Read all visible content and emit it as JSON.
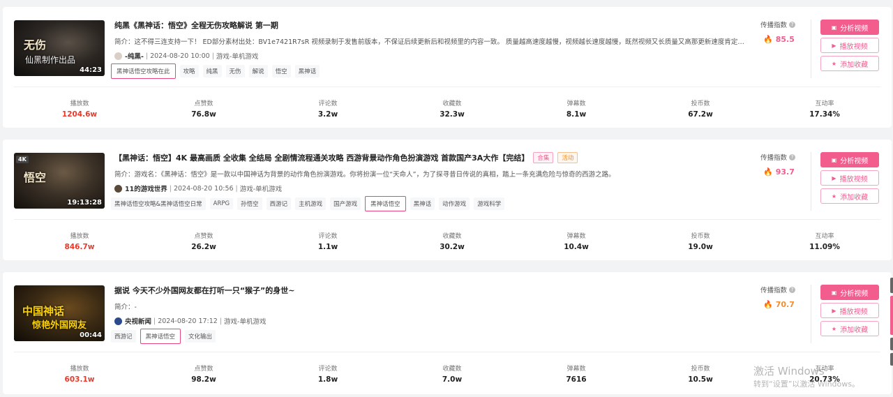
{
  "colors": {
    "accent": "#f25d8e",
    "red": "#e8392b",
    "orange": "#f08f2f"
  },
  "score_label": "传播指数",
  "buttons": {
    "analyze": "分析视频",
    "play": "播放视频",
    "favorite": "添加收藏"
  },
  "stat_labels": [
    "播放数",
    "点赞数",
    "评论数",
    "收藏数",
    "弹幕数",
    "投币数",
    "互动率"
  ],
  "videos": [
    {
      "title": "纯黑《黑神话：悟空》全程无伤攻略解说 第一期",
      "desc": "简介：这不得三连支持一下！ ED部分素材出处：BV1e7421R7sR 视频录制于发售前版本，不保证后续更新后和视频里的内容一致。 质量越高速度越慢，视频越长速度越慢，既然视频又长质量又高那更新速度肯定不...",
      "author": "-纯黑-",
      "date": "2024-08-20 10:00",
      "category": "游戏-单机游戏",
      "duration": "44:23",
      "cover_title": "无伤",
      "cover_sub": "仙黑制作出品",
      "tags": [
        "黑神话悟空攻略在此",
        "攻略",
        "纯黑",
        "无伤",
        "解说",
        "悟空",
        "黑神话"
      ],
      "highlight_tag": 0,
      "score": "85.5",
      "score_color": "#f25d8e",
      "stats": [
        "1204.6w",
        "76.8w",
        "3.2w",
        "32.3w",
        "8.1w",
        "67.2w",
        "17.34%"
      ]
    },
    {
      "title": "【黑神话：悟空】4K 最高画质 全收集 全结局 全剧情流程通关攻略 西游背景动作角色扮演游戏 首款国产3A大作【完结】",
      "chips": [
        "合集",
        "活动"
      ],
      "desc": "简介：游戏名：《黑神话：悟空》是一款以中国神话为背景的动作角色扮演游戏。你将扮演一位“天命人”，为了探寻昔日传说的真相，踏上一条充满危险与惊奇的西游之路。",
      "author": "11的游戏世界",
      "date": "2024-08-20 10:56",
      "category": "游戏-单机游戏",
      "duration": "19:13:28",
      "cover_badge": "4K",
      "cover_title": "悟空",
      "tags": [
        "黑神话悟空攻略&黑神话悟空日常",
        "ARPG",
        "孙悟空",
        "西游记",
        "主机游戏",
        "国产游戏",
        "黑神话悟空",
        "黑神话",
        "动作游戏",
        "游戏科学"
      ],
      "highlight_tag": 6,
      "score": "93.7",
      "score_color": "#f25d8e",
      "stats": [
        "846.7w",
        "26.2w",
        "1.1w",
        "30.2w",
        "10.4w",
        "19.0w",
        "11.09%"
      ]
    },
    {
      "title": "据说 今天不少外国网友都在打听一只“猴子”的身世~",
      "desc": "简介：-",
      "author": "央视新闻",
      "date": "2024-08-20 17:12",
      "category": "游戏-单机游戏",
      "duration": "00:44",
      "cover_title": "中国神话",
      "cover_sub": "惊艳外国网友",
      "tags": [
        "西游记",
        "黑神话悟空",
        "文化输出"
      ],
      "highlight_tag": 1,
      "score": "70.7",
      "score_color": "#f08f2f",
      "stats": [
        "603.1w",
        "98.2w",
        "1.8w",
        "7.0w",
        "7616",
        "10.5w",
        "20.73%"
      ]
    }
  ],
  "watermark": {
    "line1": "激活 Windows",
    "line2": "转到“设置”以激活 Windows。"
  }
}
